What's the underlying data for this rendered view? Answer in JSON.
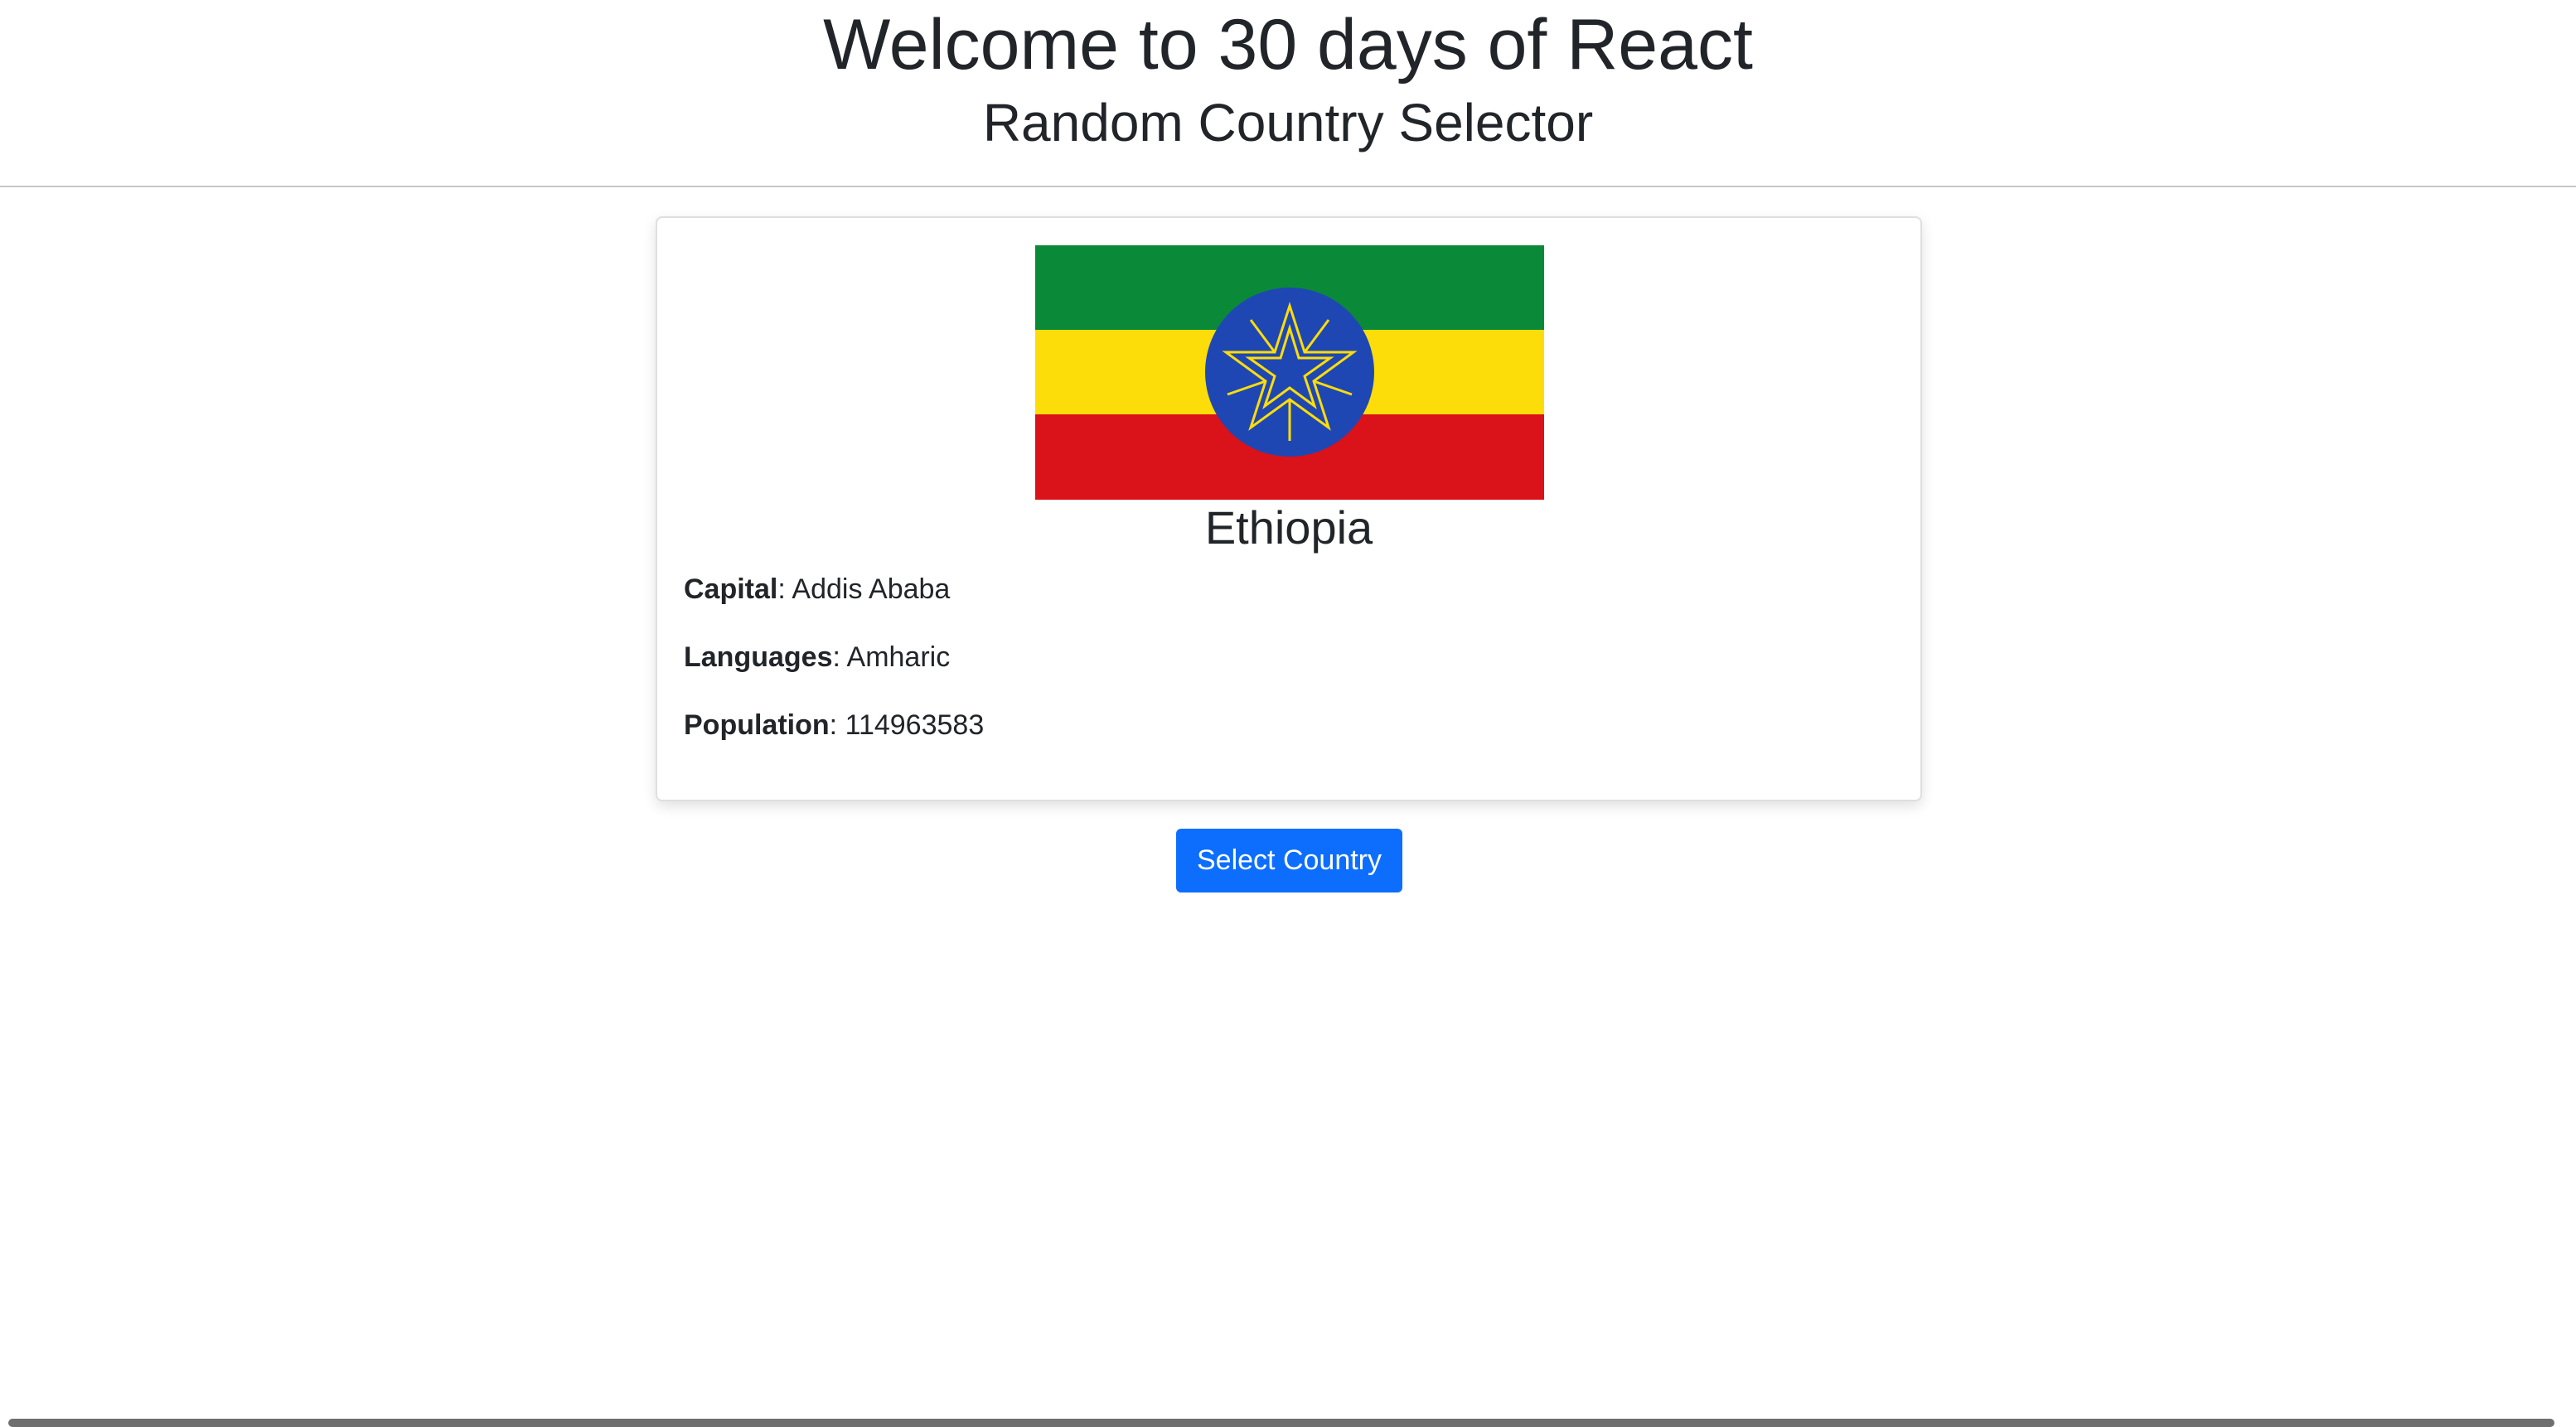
{
  "header": {
    "title": "Welcome to 30 days of React",
    "subtitle": "Random Country Selector"
  },
  "country": {
    "name": "Ethiopia",
    "flag_colors": {
      "green": "#0a8a38",
      "yellow": "#fcdd09",
      "red": "#da121a",
      "blue": "#1f47b4",
      "star": "#fcdd09"
    },
    "details": [
      {
        "label": "Capital",
        "separator": ": ",
        "value": "Addis Ababa"
      },
      {
        "label": "Languages",
        "separator": ": ",
        "value": "Amharic"
      },
      {
        "label": "Population",
        "separator": ": ",
        "value": "114963583"
      }
    ]
  },
  "actions": {
    "select_label": "Select Country",
    "accent": "#0d6efd"
  }
}
